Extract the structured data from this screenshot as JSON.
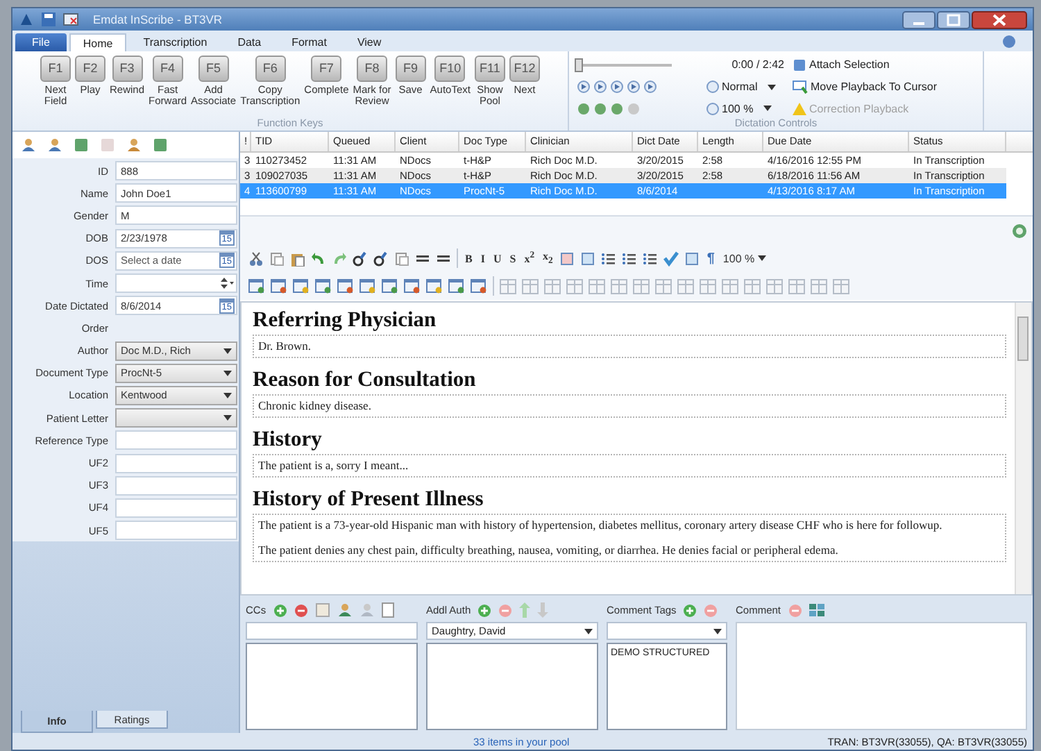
{
  "window": {
    "title": "Emdat InScribe - BT3VR"
  },
  "menu_tabs": [
    {
      "label": "File",
      "kind": "file",
      "selected": false
    },
    {
      "label": "Home",
      "kind": "tab",
      "selected": true
    },
    {
      "label": "Transcription",
      "kind": "tab",
      "selected": false
    },
    {
      "label": "Data",
      "kind": "tab",
      "selected": false
    },
    {
      "label": "Format",
      "kind": "tab",
      "selected": false
    },
    {
      "label": "View",
      "kind": "tab",
      "selected": false
    }
  ],
  "ribbon": {
    "function_keys_title": "Function Keys",
    "function_keys": [
      {
        "key": "F1",
        "label_lines": [
          "Next",
          "Field"
        ]
      },
      {
        "key": "F2",
        "label_lines": [
          "Play"
        ]
      },
      {
        "key": "F3",
        "label_lines": [
          "Rewind"
        ]
      },
      {
        "key": "F4",
        "label_lines": [
          "Fast",
          "Forward"
        ]
      },
      {
        "key": "F5",
        "label_lines": [
          "Add",
          "Associate"
        ]
      },
      {
        "key": "F6",
        "label_lines": [
          "Copy",
          "Transcription"
        ]
      },
      {
        "key": "F7",
        "label_lines": [
          "Complete"
        ]
      },
      {
        "key": "F8",
        "label_lines": [
          "Mark for",
          "Review"
        ]
      },
      {
        "key": "F9",
        "label_lines": [
          "Save"
        ]
      },
      {
        "key": "F10",
        "label_lines": [
          "AutoText"
        ]
      },
      {
        "key": "F11",
        "label_lines": [
          "Show",
          "Pool"
        ]
      },
      {
        "key": "F12",
        "label_lines": [
          "Next"
        ]
      }
    ],
    "dictation": {
      "title": "Dictation Controls",
      "position": "0:00 / 2:42",
      "level": 0,
      "speed": "Normal",
      "volume": "100 %",
      "attach": "Attach Selection",
      "move": "Move Playback To Cursor",
      "correction": {
        "label": "Correction Playback",
        "disabled": true
      }
    }
  },
  "patient_form": {
    "fields": [
      {
        "label": "ID",
        "kind": "text",
        "value": "888"
      },
      {
        "label": "Name",
        "kind": "text",
        "value": "John Doe1"
      },
      {
        "label": "Gender",
        "kind": "text",
        "value": "M"
      },
      {
        "label": "DOB",
        "kind": "date",
        "value": "2/23/1978",
        "calendar": "15"
      },
      {
        "label": "DOS",
        "kind": "date",
        "placeholder": "Select a date",
        "calendar": "15"
      },
      {
        "label": "Time",
        "kind": "time"
      },
      {
        "label": "Date Dictated",
        "kind": "date",
        "value": "8/6/2014",
        "calendar": "15"
      },
      {
        "label": "Order",
        "kind": "none"
      },
      {
        "label": "Author",
        "kind": "select",
        "value": "Doc M.D., Rich"
      },
      {
        "label": "Document Type",
        "kind": "select",
        "value": "ProcNt-5"
      },
      {
        "label": "Location",
        "kind": "select",
        "value": "Kentwood"
      },
      {
        "label": "Patient Letter",
        "kind": "select"
      },
      {
        "label": "Reference Type",
        "kind": "text"
      },
      {
        "label": "UF2",
        "kind": "text"
      },
      {
        "label": "UF3",
        "kind": "text"
      },
      {
        "label": "UF4",
        "kind": "text"
      },
      {
        "label": "UF5",
        "kind": "text"
      }
    ],
    "tabs": [
      {
        "label": "Info",
        "selected": true
      },
      {
        "label": "Ratings",
        "selected": false
      }
    ]
  },
  "queue": {
    "columns": [
      "!",
      "TID",
      "Queued",
      "Client",
      "Doc Type",
      "Clinician",
      "Dict Date",
      "Length",
      "Due Date",
      "Status"
    ],
    "rows": [
      {
        "cells": [
          "3",
          "110273452",
          "11:31 AM",
          "NDocs",
          "t-H&P",
          "Rich Doc M.D.",
          "3/20/2015",
          "2:58",
          "4/16/2016 12:55 PM",
          "In Transcription"
        ],
        "selected": false
      },
      {
        "cells": [
          "3",
          "109027035",
          "11:31 AM",
          "NDocs",
          "t-H&P",
          "Rich Doc M.D.",
          "3/20/2015",
          "2:58",
          "6/18/2016 11:56 AM",
          "In Transcription"
        ],
        "selected": false
      },
      {
        "cells": [
          "4",
          "113600799",
          "11:31 AM",
          "NDocs",
          "ProcNt-5",
          "Rich Doc M.D.",
          "8/6/2014",
          "",
          "4/13/2016 8:17 AM",
          "In Transcription"
        ],
        "selected": true
      }
    ]
  },
  "format_toolbar": {
    "text_buttons": [
      "B",
      "I",
      "U",
      "S",
      "x$^{2}$",
      "x$_{2}$"
    ],
    "paragraph": "¶",
    "zoom": "100 %"
  },
  "document": {
    "sections": [
      {
        "heading": "Referring Physician",
        "paragraphs": [
          "Dr. Brown."
        ]
      },
      {
        "heading": "Reason for Consultation",
        "paragraphs": [
          "Chronic kidney disease."
        ]
      },
      {
        "heading": "History",
        "paragraphs": [
          "The patient is a, sorry I meant..."
        ]
      },
      {
        "heading": "History of Present Illness",
        "paragraphs": [
          "The patient is a 73-year-old Hispanic man with history of hypertension, diabetes mellitus, coronary artery disease CHF who is here for followup.",
          "The patient denies any chest pain, difficulty breathing, nausea, vomiting, or diarrhea.  He denies facial or peripheral edema."
        ]
      }
    ]
  },
  "bottom": {
    "ccs": {
      "label": "CCs"
    },
    "addl_auth": {
      "label": "Addl Auth",
      "value": "Daughtry, David"
    },
    "comment_tags": {
      "label": "Comment Tags",
      "items": [
        "DEMO STRUCTURED"
      ]
    },
    "comment": {
      "label": "Comment"
    }
  },
  "status_bar": {
    "pool": "33 items in your pool",
    "user": "TRAN: BT3VR(33055), QA: BT3VR(33055)"
  }
}
